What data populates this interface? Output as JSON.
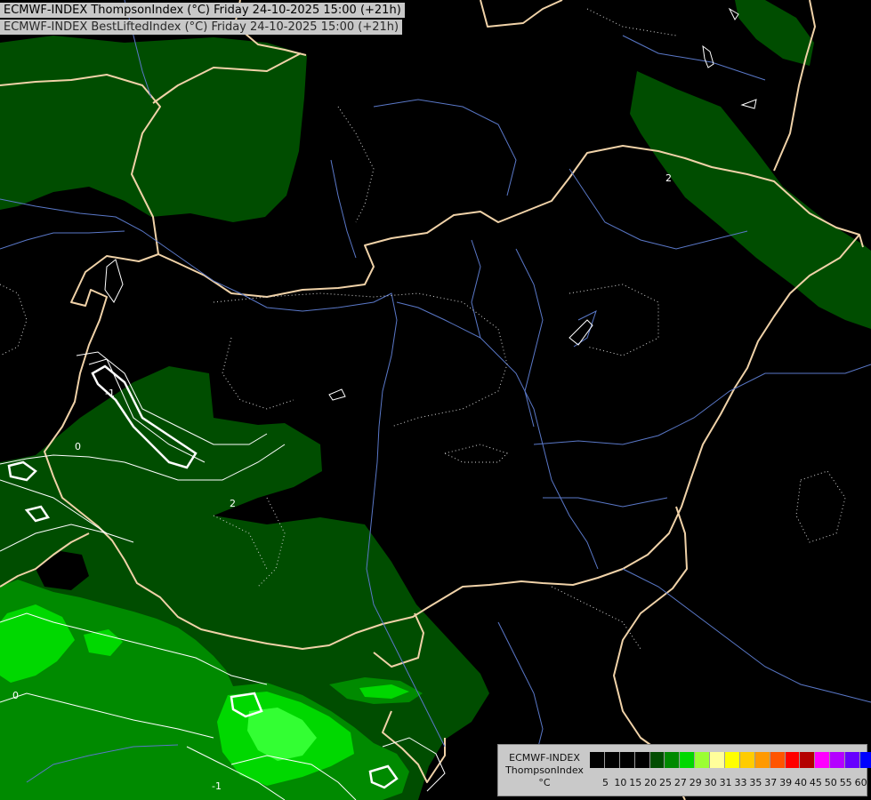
{
  "header": {
    "line1": "ECMWF-INDEX ThompsonIndex (°C) Friday 24-10-2025 15:00 (+21h)",
    "line2": "ECMWF-INDEX BestLiftedIndex (°C) Friday 24-10-2025 15:00 (+21h)"
  },
  "map": {
    "background_color": "#000000",
    "border_color": "#f0d2a8",
    "river_color": "#5a78c8",
    "contour_color": "#ffffff",
    "contour_labels": [
      "2",
      "0",
      "-1",
      "2",
      "0",
      "-1"
    ]
  },
  "legend": {
    "title_lines": [
      "ECMWF-INDEX",
      "ThompsonIndex",
      "°C"
    ],
    "labels": [
      "5",
      "10",
      "15",
      "20",
      "25",
      "27",
      "29",
      "30",
      "31",
      "33",
      "35",
      "37",
      "39",
      "40",
      "45",
      "50",
      "55",
      "60"
    ],
    "colors": [
      "#000000",
      "#000000",
      "#000000",
      "#000000",
      "#004d00",
      "#008a00",
      "#00d800",
      "#9bff33",
      "#ffff9b",
      "#ffff00",
      "#ffcc00",
      "#ff9900",
      "#ff5500",
      "#ff0000",
      "#b40000",
      "#ff00ff",
      "#b400ff",
      "#6600ff",
      "#0000ff"
    ]
  }
}
